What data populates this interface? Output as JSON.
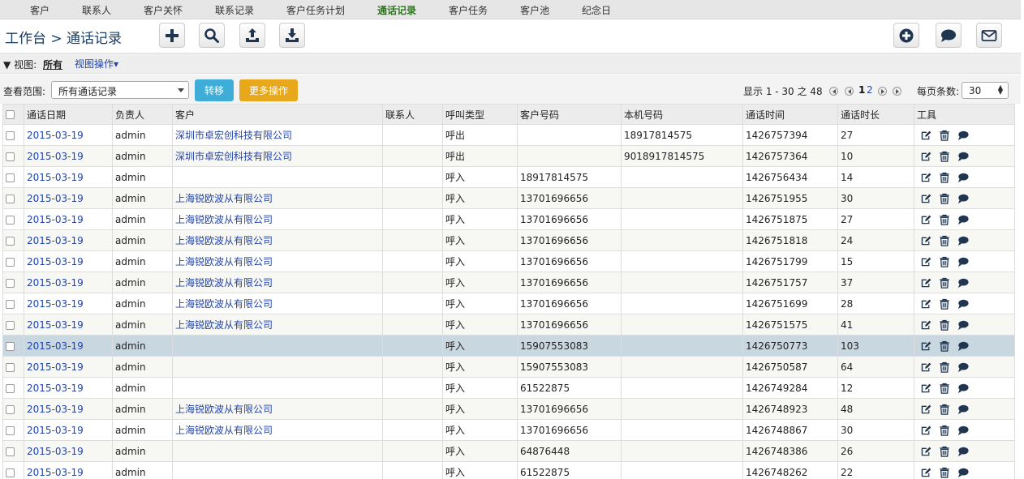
{
  "nav": {
    "items": [
      "客户",
      "联系人",
      "客户关怀",
      "联系记录",
      "客户任务计划",
      "通话记录",
      "客户任务",
      "客户池",
      "纪念日"
    ],
    "active_index": 5
  },
  "header": {
    "title": "工作台 > 通话记录"
  },
  "viewbar": {
    "view_label": "视图:",
    "view_all": "所有",
    "view_ops": "视图操作"
  },
  "filter": {
    "scope_label": "查看范围:",
    "scope_value": "所有通话记录",
    "transfer_label": "转移",
    "more_ops_label": "更多操作",
    "pager_text": "显示 1 - 30 之 48",
    "page_current": "1",
    "page_next": "2",
    "perpage_label": "每页条数:",
    "perpage_value": "30"
  },
  "colors": {
    "active_nav": "#2a7a1a",
    "link": "#2244aa",
    "transfer_button": "#3eaed8",
    "more_button": "#e8a81c",
    "selected_row": "#c9d8e0"
  },
  "table": {
    "headers": [
      "通话日期",
      "负责人",
      "客户",
      "联系人",
      "呼叫类型",
      "客户号码",
      "本机号码",
      "通话时间",
      "通话时长",
      "工具"
    ],
    "rows": [
      [
        "2015-03-19",
        "admin",
        "深圳市卓宏创科技有限公司",
        "",
        "呼出",
        "",
        "18917814575",
        "1426757394",
        "27"
      ],
      [
        "2015-03-19",
        "admin",
        "深圳市卓宏创科技有限公司",
        "",
        "呼出",
        "",
        "9018917814575",
        "1426757364",
        "10"
      ],
      [
        "2015-03-19",
        "admin",
        "",
        "",
        "呼入",
        "18917814575",
        "",
        "1426756434",
        "14"
      ],
      [
        "2015-03-19",
        "admin",
        "上海锐欧波从有限公司",
        "",
        "呼入",
        "13701696656",
        "",
        "1426751955",
        "30"
      ],
      [
        "2015-03-19",
        "admin",
        "上海锐欧波从有限公司",
        "",
        "呼入",
        "13701696656",
        "",
        "1426751875",
        "27"
      ],
      [
        "2015-03-19",
        "admin",
        "上海锐欧波从有限公司",
        "",
        "呼入",
        "13701696656",
        "",
        "1426751818",
        "24"
      ],
      [
        "2015-03-19",
        "admin",
        "上海锐欧波从有限公司",
        "",
        "呼入",
        "13701696656",
        "",
        "1426751799",
        "15"
      ],
      [
        "2015-03-19",
        "admin",
        "上海锐欧波从有限公司",
        "",
        "呼入",
        "13701696656",
        "",
        "1426751757",
        "37"
      ],
      [
        "2015-03-19",
        "admin",
        "上海锐欧波从有限公司",
        "",
        "呼入",
        "13701696656",
        "",
        "1426751699",
        "28"
      ],
      [
        "2015-03-19",
        "admin",
        "上海锐欧波从有限公司",
        "",
        "呼入",
        "13701696656",
        "",
        "1426751575",
        "41"
      ],
      [
        "2015-03-19",
        "admin",
        "",
        "",
        "呼入",
        "15907553083",
        "",
        "1426750773",
        "103"
      ],
      [
        "2015-03-19",
        "admin",
        "",
        "",
        "呼入",
        "15907553083",
        "",
        "1426750587",
        "64"
      ],
      [
        "2015-03-19",
        "admin",
        "",
        "",
        "呼入",
        "61522875",
        "",
        "1426749284",
        "12"
      ],
      [
        "2015-03-19",
        "admin",
        "上海锐欧波从有限公司",
        "",
        "呼入",
        "13701696656",
        "",
        "1426748923",
        "48"
      ],
      [
        "2015-03-19",
        "admin",
        "上海锐欧波从有限公司",
        "",
        "呼入",
        "13701696656",
        "",
        "1426748867",
        "30"
      ],
      [
        "2015-03-19",
        "admin",
        "",
        "",
        "呼入",
        "64876448",
        "",
        "1426748386",
        "26"
      ],
      [
        "2015-03-19",
        "admin",
        "",
        "",
        "呼入",
        "61522875",
        "",
        "1426748262",
        "22"
      ]
    ],
    "selected_row_index": 10,
    "row_tools": [
      "edit-icon",
      "trash-icon",
      "comment-icon"
    ]
  }
}
